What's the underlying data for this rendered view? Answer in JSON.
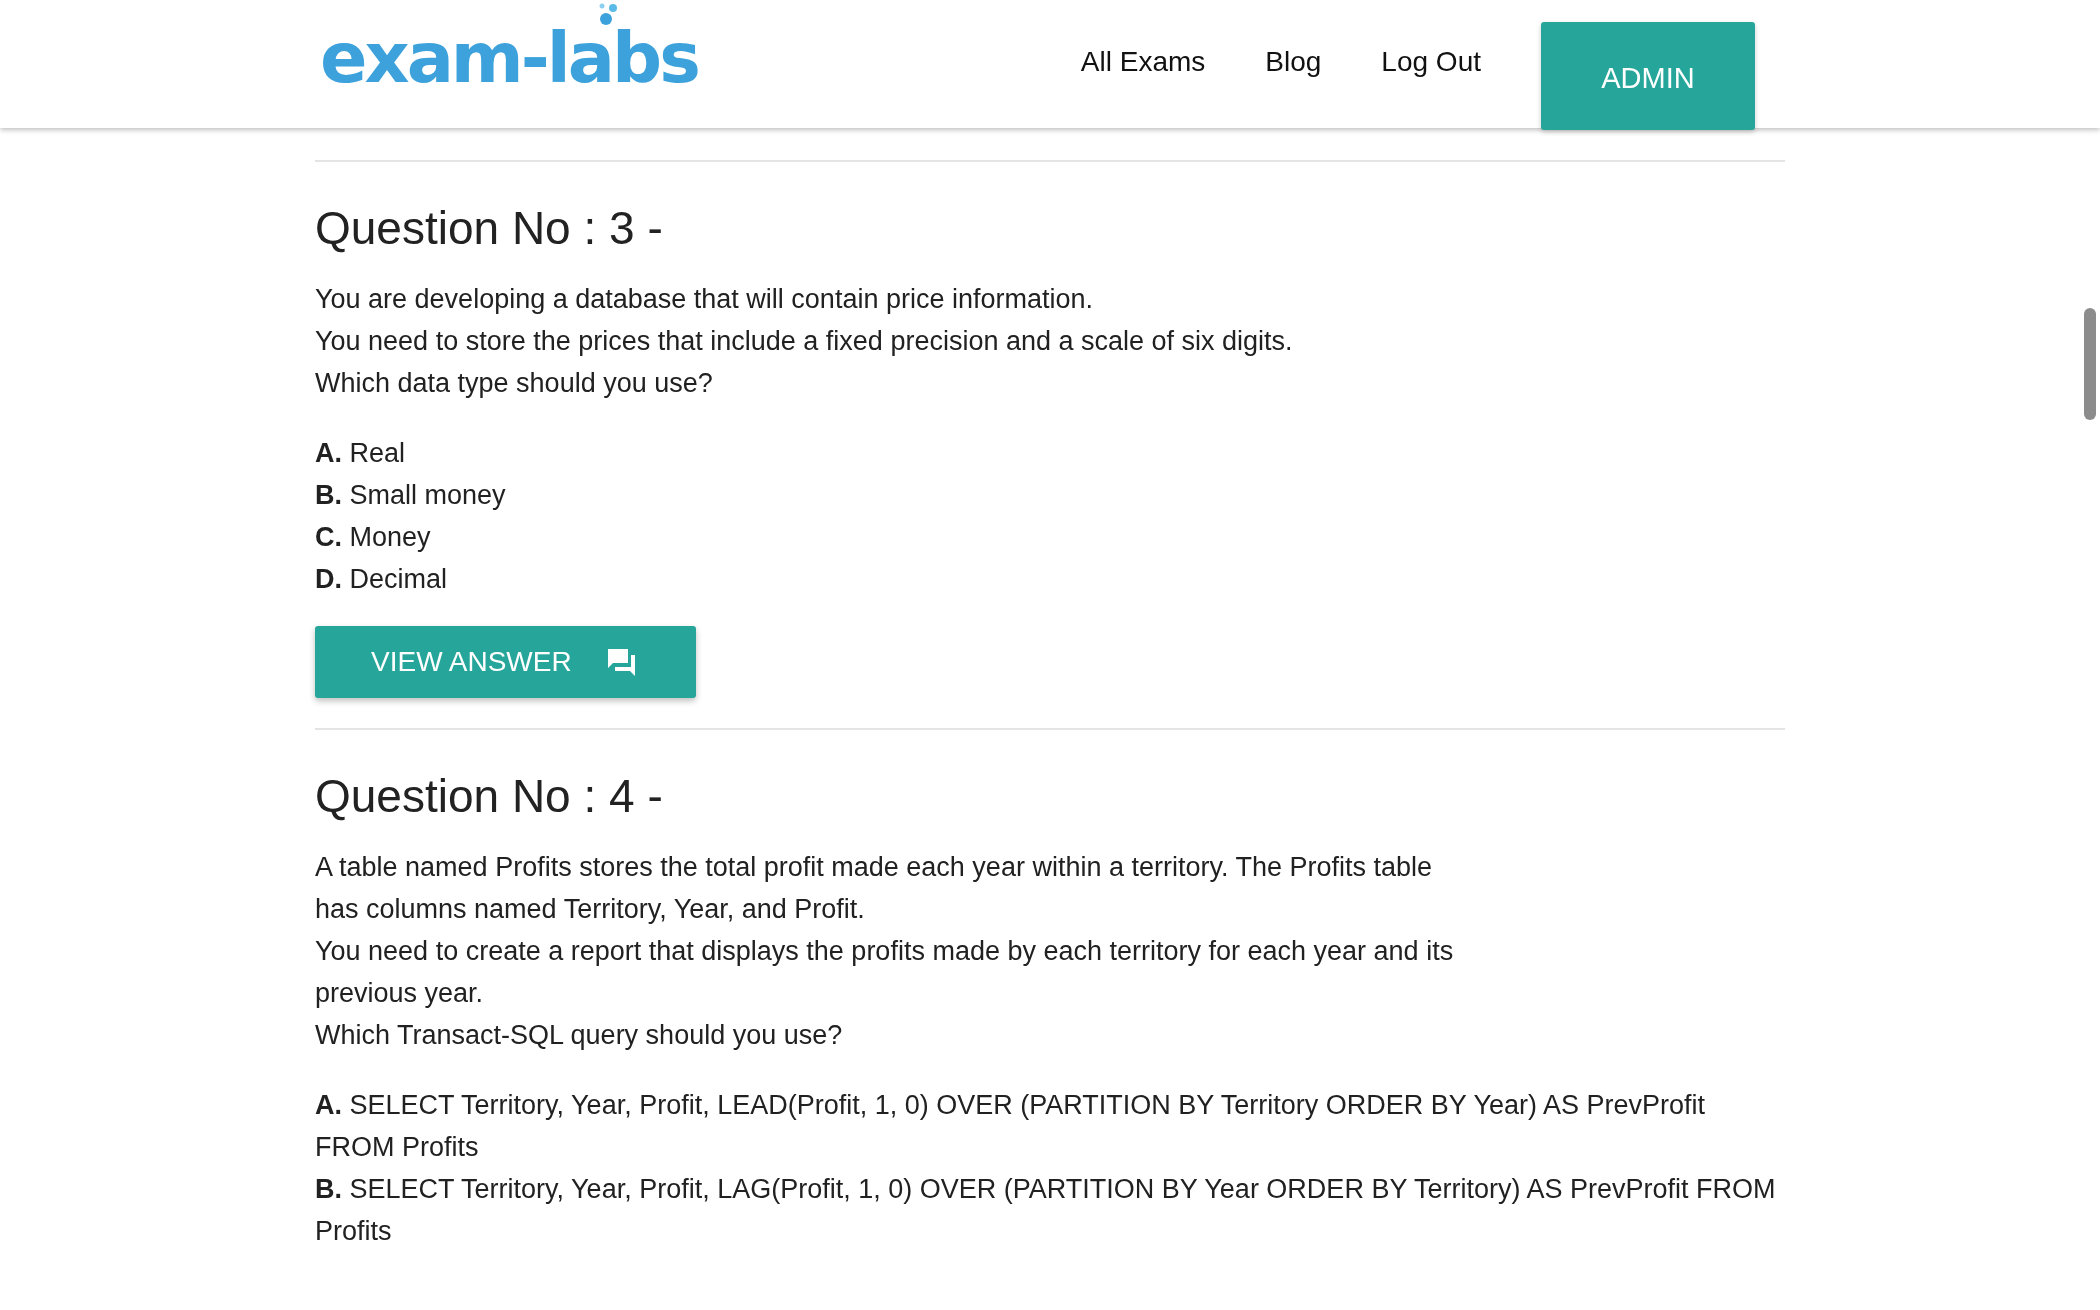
{
  "header": {
    "logo": "exam-labs",
    "nav": [
      "All Exams",
      "Blog",
      "Log Out"
    ],
    "admin_button": "ADMIN"
  },
  "questions": [
    {
      "title": "Question No : 3 -",
      "paragraphs": [
        "You are developing a database that will contain price information.",
        "You need to store the prices that include a fixed precision and a scale of six digits.",
        "Which data type should you use?"
      ],
      "options": [
        {
          "letter": "A.",
          "text": "Real"
        },
        {
          "letter": "B.",
          "text": "Small money"
        },
        {
          "letter": "C.",
          "text": "Money"
        },
        {
          "letter": "D.",
          "text": "Decimal"
        }
      ],
      "button": "VIEW ANSWER"
    },
    {
      "title": "Question No : 4 -",
      "paragraphs": [
        "A table named Profits stores the total profit made each year within a territory. The Profits table has columns named Territory, Year, and Profit.",
        "You need to create a report that displays the profits made by each territory for each year and its previous year.",
        "Which Transact-SQL query should you use?"
      ],
      "options": [
        {
          "letter": "A.",
          "text": "SELECT Territory, Year, Profit, LEAD(Profit, 1, 0) OVER (PARTITION BY Territory ORDER BY Year) AS PrevProfit FROM Profits"
        },
        {
          "letter": "B.",
          "text": "SELECT Territory, Year, Profit, LAG(Profit, 1, 0) OVER (PARTITION BY Year ORDER BY Territory) AS PrevProfit FROM Profits"
        }
      ]
    }
  ]
}
